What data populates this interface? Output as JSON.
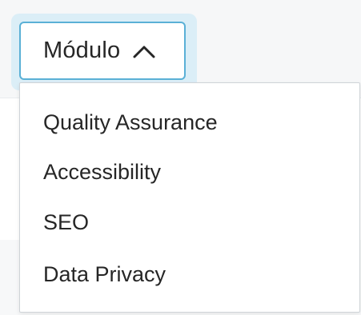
{
  "dropdown": {
    "label": "Módulo",
    "expanded": true,
    "chevron_icon": "chevron-up-icon",
    "options": [
      {
        "label": "Quality Assurance"
      },
      {
        "label": "Accessibility"
      },
      {
        "label": "SEO"
      },
      {
        "label": "Data Privacy"
      }
    ]
  },
  "colors": {
    "trigger_border": "#5ab0d6",
    "trigger_halo": "#dbeef7",
    "text": "#262626",
    "menu_border": "#cfd4d8"
  }
}
